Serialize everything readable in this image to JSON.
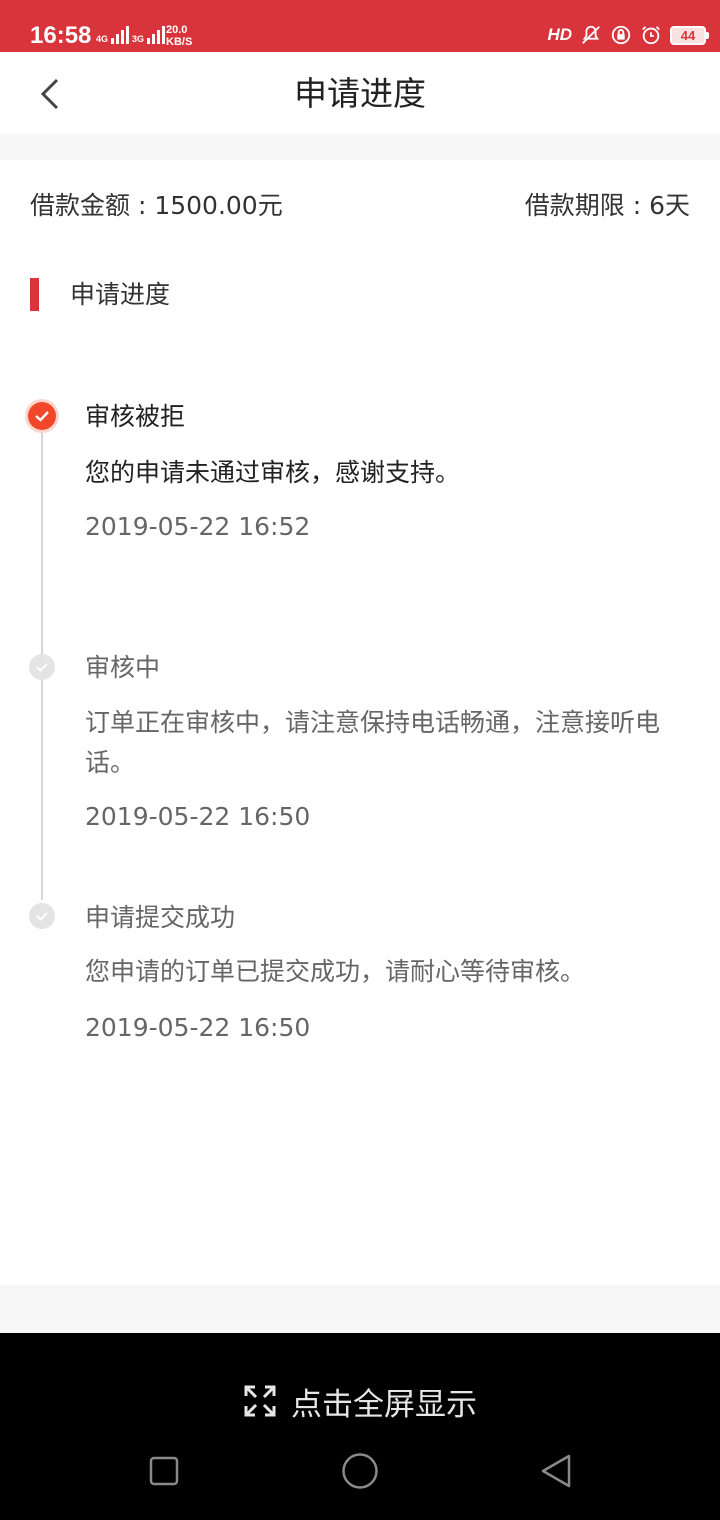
{
  "status_bar": {
    "time": "16:58",
    "net1": "4G",
    "net2": "3G",
    "speed_value": "20.0",
    "speed_unit": "KB/S",
    "hd_label": "HD",
    "battery": "44"
  },
  "header": {
    "title": "申请进度"
  },
  "loan": {
    "amount_text": "借款金额 : 1500.00元",
    "term_text": "借款期限 : 6天"
  },
  "section": {
    "title": "申请进度"
  },
  "timeline": [
    {
      "title": "审核被拒",
      "desc": "您的申请未通过审核，感谢支持。",
      "time": "2019-05-22 16:52",
      "state": "active"
    },
    {
      "title": "审核中",
      "desc": "订单正在审核中，请注意保持电话畅通，注意接听电话。",
      "time": "2019-05-22 16:50",
      "state": "inactive"
    },
    {
      "title": "申请提交成功",
      "desc": "您申请的订单已提交成功，请耐心等待审核。",
      "time": "2019-05-22 16:50",
      "state": "inactive"
    }
  ],
  "bottom": {
    "fullscreen_label": "点击全屏显示"
  },
  "colors": {
    "brand_red": "#d9343b",
    "active_orange": "#f2472a"
  }
}
